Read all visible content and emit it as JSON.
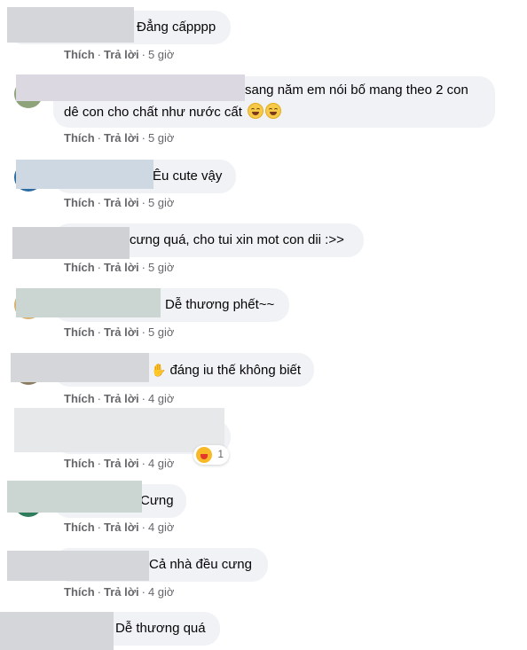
{
  "actions": {
    "like": "Thích",
    "reply": "Trả lời",
    "separator": "·"
  },
  "comments": [
    {
      "text": "Đẳng cấpppp",
      "time": "5 giờ"
    },
    {
      "text_line1": "sang năm em nói bố mang theo 2 con",
      "text_line2": "dê con cho chất như nước cất",
      "emojis": [
        "smiling-face-emoji",
        "smiling-face-emoji"
      ],
      "time": "5 giờ"
    },
    {
      "text": "Êu cute vậy",
      "time": "5 giờ"
    },
    {
      "text": "cưng quá, cho tui xin mot con dii :>>",
      "time": "5 giờ"
    },
    {
      "text": "Dễ thương phết~~",
      "time": "5 giờ"
    },
    {
      "text": "đáng iu thế không biết",
      "icon": "hand-icon",
      "time": "4 giờ"
    },
    {
      "text": "",
      "reaction": {
        "icon": "haha-reaction-icon",
        "count": "1"
      },
      "time": "4 giờ"
    },
    {
      "text": "Cưng",
      "time": "4 giờ"
    },
    {
      "text": "Cả nhà đều cưng",
      "time": "4 giờ"
    },
    {
      "text": "Dễ thương quá",
      "time": ""
    }
  ],
  "colors": {
    "bubble": "#f0f2f5",
    "meta": "#65676b",
    "text": "#050505"
  }
}
